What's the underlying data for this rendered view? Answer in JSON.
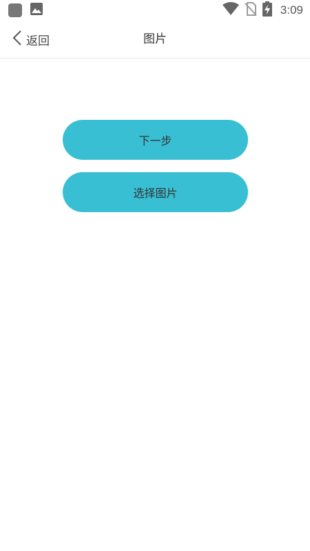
{
  "status_bar": {
    "time": "3:09",
    "left_icons": [
      "app-icon",
      "image-icon"
    ],
    "right_icons": [
      "wifi-icon",
      "no-sim-icon",
      "battery-charging-icon"
    ]
  },
  "header": {
    "back_label": "返回",
    "title": "图片"
  },
  "actions": {
    "next_label": "下一步",
    "select_image_label": "选择图片"
  },
  "colors": {
    "button_bg": "#39bfd3",
    "icon_gray": "#666666"
  }
}
